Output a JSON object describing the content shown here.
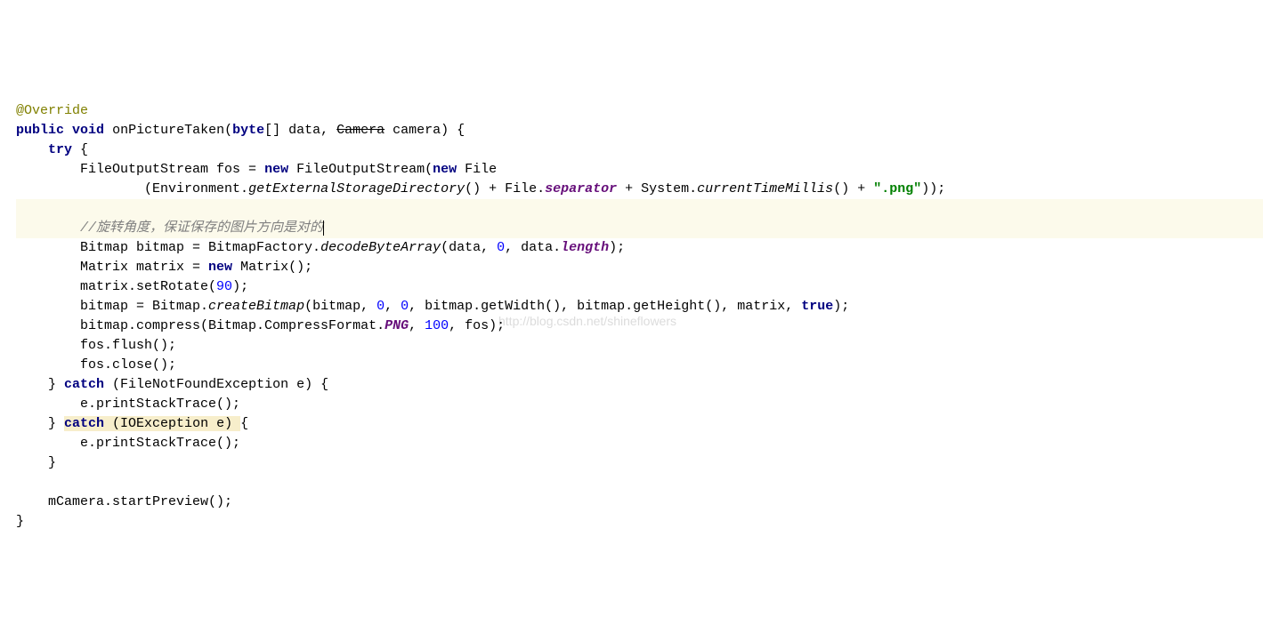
{
  "code": {
    "annotation": "@Override",
    "kw_public": "public",
    "kw_void": "void",
    "method_name": "onPictureTaken",
    "kw_byte": "byte",
    "param_data": "[] data, ",
    "type_camera": "Camera",
    "param_camera": " camera) {",
    "kw_try": "try",
    "brace_open": " {",
    "line_fos_decl": "FileOutputStream fos = ",
    "kw_new1": "new",
    "txt_fos": " FileOutputStream(",
    "kw_new2": "new",
    "txt_file": " File",
    "txt_env_pre": "(Environment.",
    "ital_getExt": "getExternalStorageDirectory",
    "txt_env_post": "() + File.",
    "field_sep": "separator",
    "txt_sys_pre": " + System.",
    "ital_ctm": "currentTimeMillis",
    "txt_sys_post": "() + ",
    "str_png_ext": "\".png\"",
    "txt_line_end1": "));",
    "comment_rotate": "//旋转角度，保证保存的图片方向是对的",
    "txt_bitmap_decl": "Bitmap bitmap = BitmapFactory.",
    "ital_decode": "decodeByteArray",
    "txt_decode_args_a": "(data, ",
    "num_0a": "0",
    "txt_decode_args_b": ", data.",
    "field_length": "length",
    "txt_decode_end": ");",
    "txt_matrix_decl": "Matrix matrix = ",
    "kw_new3": "new",
    "txt_matrix_end": " Matrix();",
    "txt_setrotate_a": "matrix.setRotate(",
    "num_90": "90",
    "txt_setrotate_b": ");",
    "txt_create_a": "bitmap = Bitmap.",
    "ital_create": "createBitmap",
    "txt_create_b": "(bitmap, ",
    "num_0b": "0",
    "txt_create_c": ", ",
    "num_0c": "0",
    "txt_create_d": ", bitmap.getWidth(), bitmap.getHeight(), matrix, ",
    "kw_true": "true",
    "txt_create_e": ");",
    "txt_compress_a": "bitmap.compress(Bitmap.CompressFormat.",
    "field_png": "PNG",
    "txt_compress_b": ", ",
    "num_100": "100",
    "txt_compress_c": ", fos);",
    "txt_flush": "fos.flush();",
    "txt_close": "fos.close();",
    "txt_catch1_a": "} ",
    "kw_catch1": "catch",
    "txt_catch1_b": " (FileNotFoundException e) {",
    "txt_pst1": "e.printStackTrace();",
    "txt_catch2_a": "} ",
    "kw_catch2": "catch",
    "txt_catch2_b": " (IOException e) ",
    "txt_catch2_c": "{",
    "txt_pst2": "e.printStackTrace();",
    "brace_close1": "}",
    "txt_mcamera": "mCamera.startPreview();",
    "brace_close2": "}"
  },
  "watermark": "http://blog.csdn.net/shineflowers"
}
